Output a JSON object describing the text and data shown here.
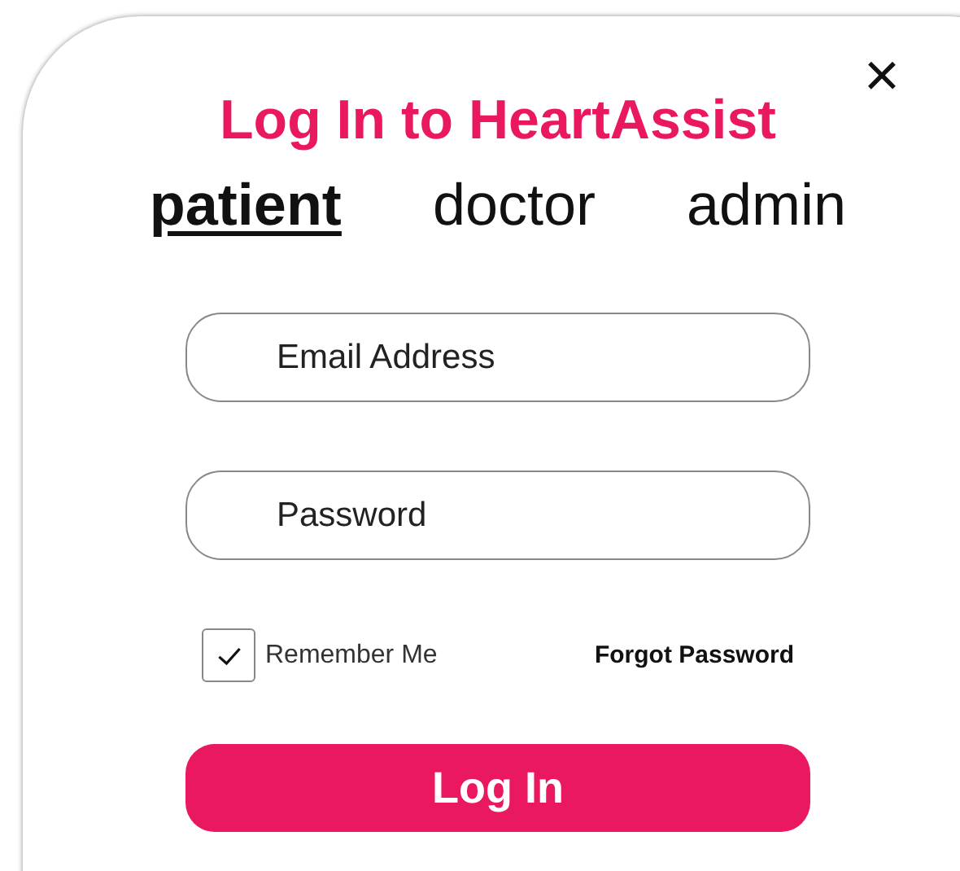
{
  "dialog": {
    "title": "Log In to HeartAssist",
    "close": "×"
  },
  "tabs": [
    {
      "label": "patient",
      "selected": true
    },
    {
      "label": "doctor",
      "selected": false
    },
    {
      "label": "admin",
      "selected": false
    }
  ],
  "fields": [
    {
      "placeholder": "Email Address"
    },
    {
      "placeholder": "Password"
    }
  ],
  "remember": {
    "label": "Remember Me",
    "checked": true
  },
  "forgot_link": "Forgot Password",
  "submit": "Log In"
}
